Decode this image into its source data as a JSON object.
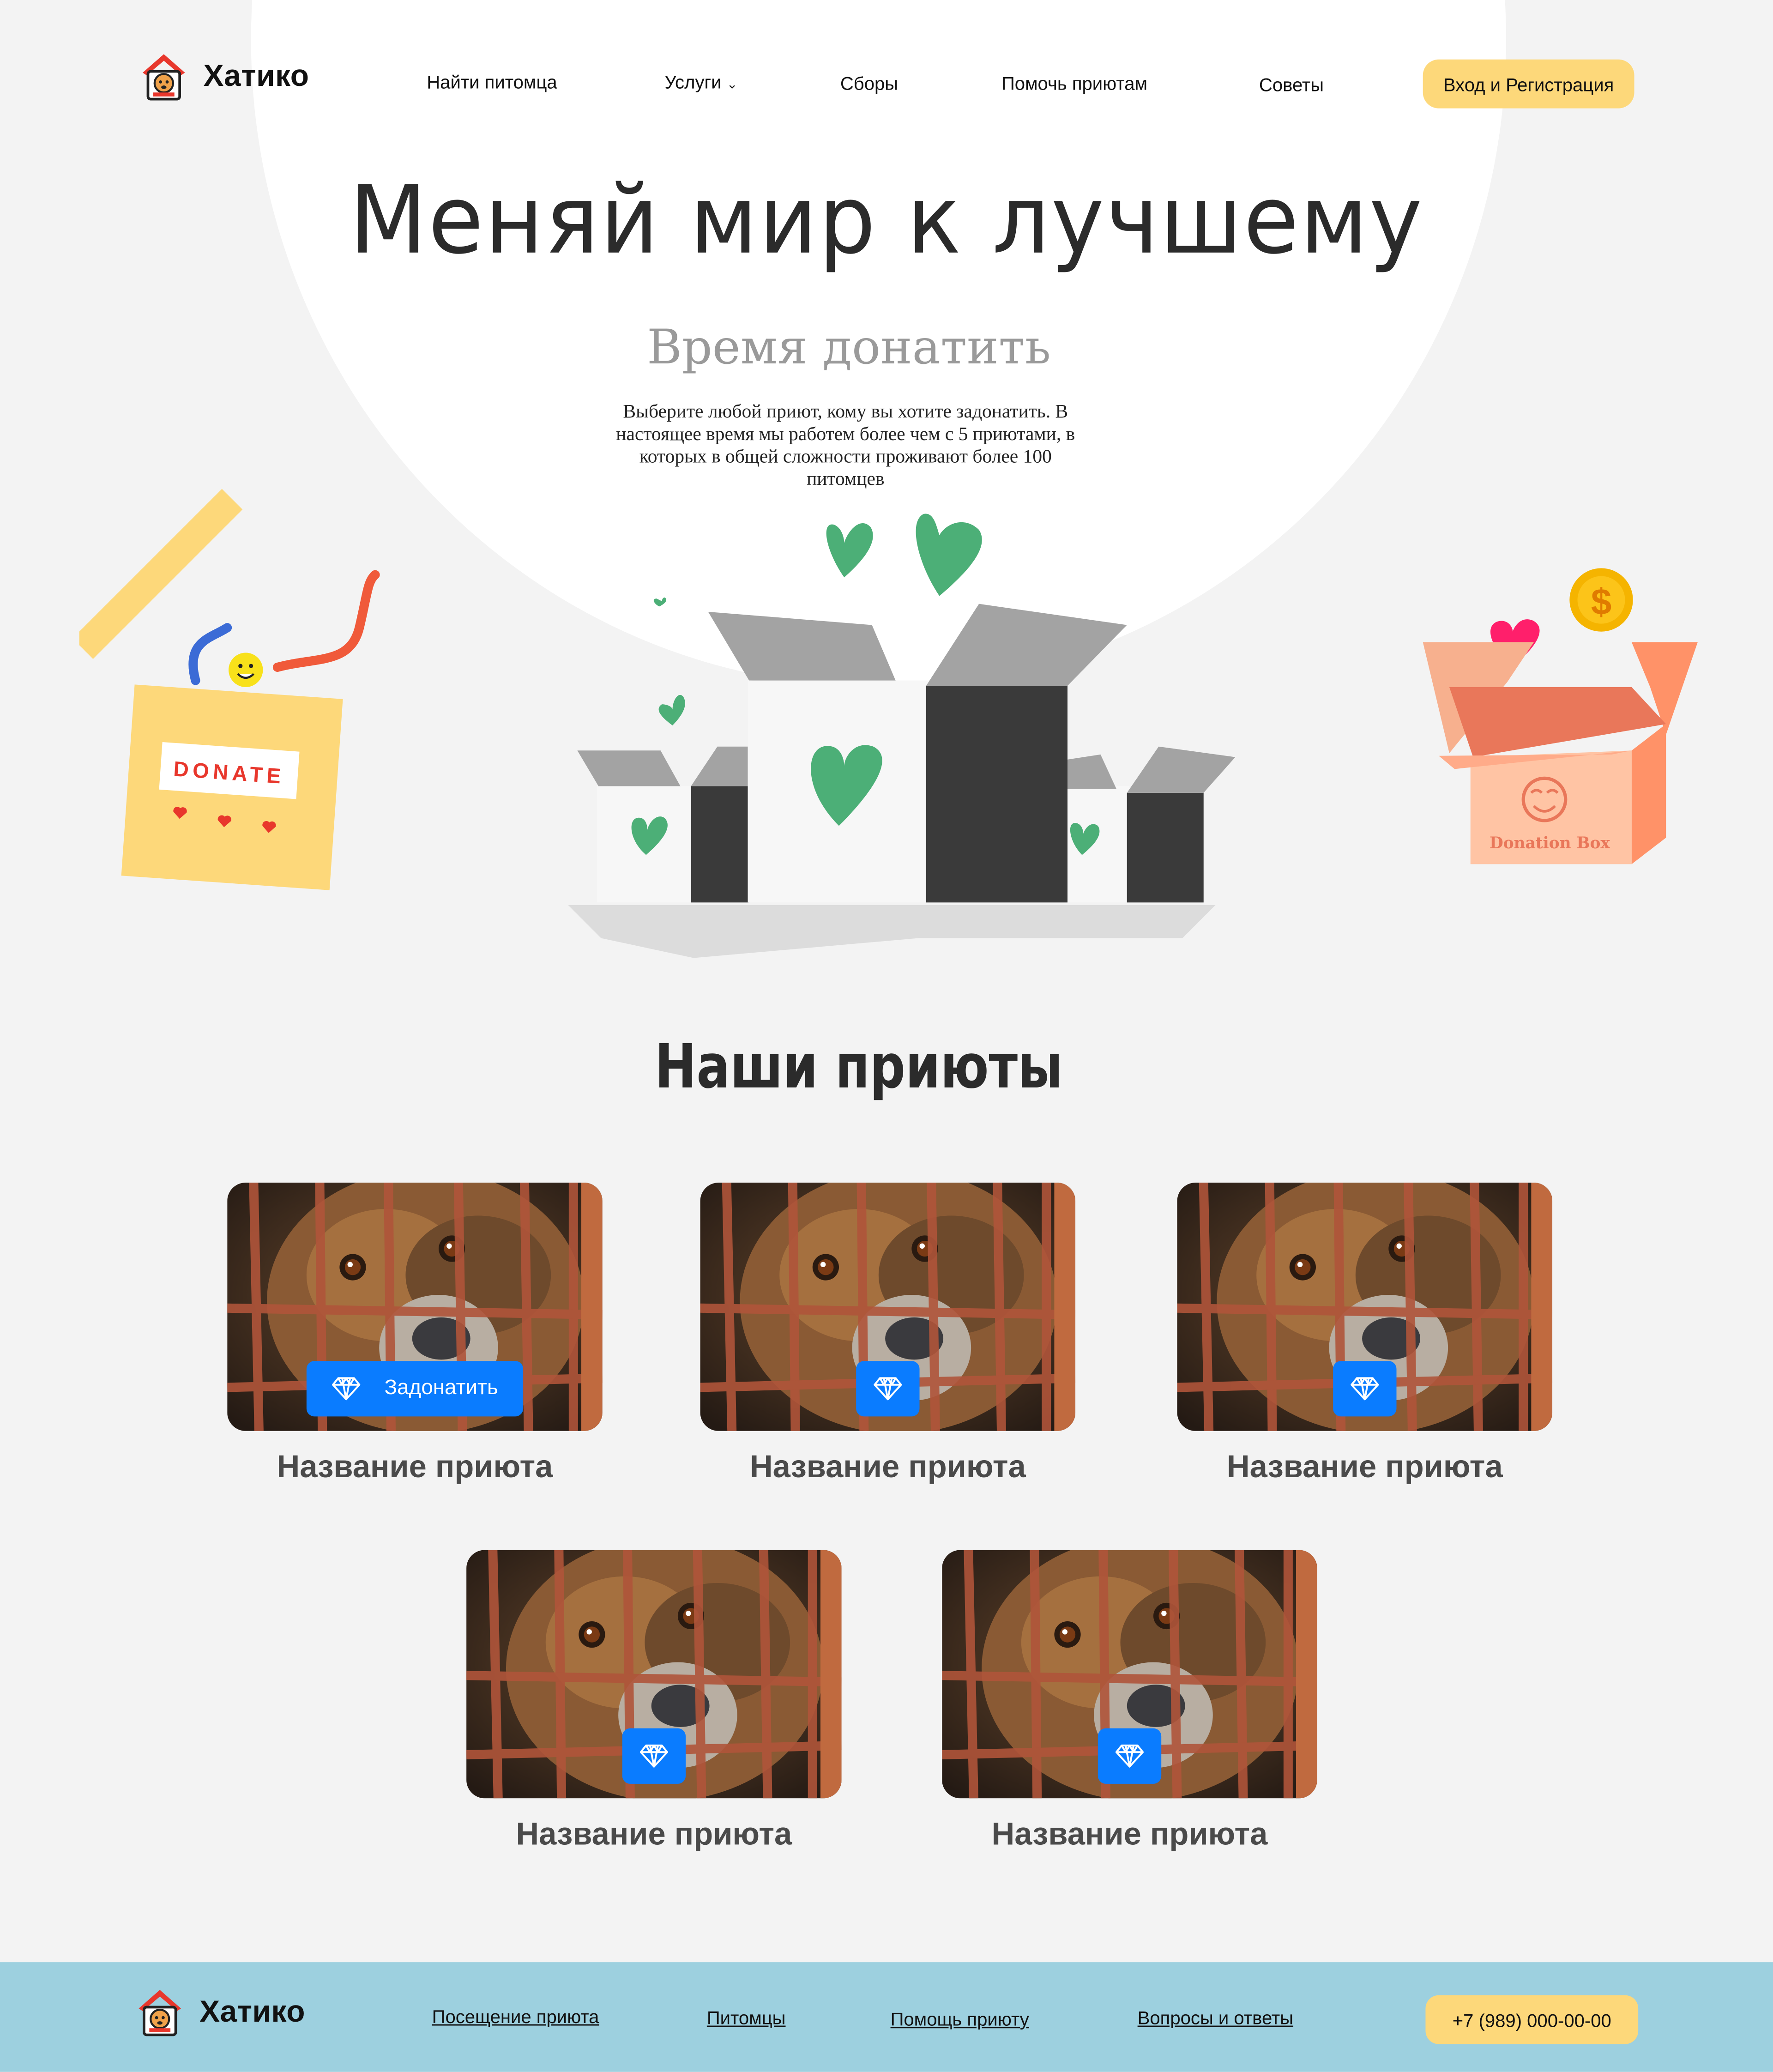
{
  "brand": {
    "name": "Хатико",
    "logo_icon": "dog-house-icon"
  },
  "nav": {
    "items": [
      "Найти питомца",
      "Услуги",
      "Сборы",
      "Помочь приютам",
      "Советы"
    ],
    "login": "Вход и Регистрация"
  },
  "hero": {
    "title": "Меняй мир к лучшему",
    "subtitle": "Время донатить",
    "text": "Выберите любой приют, кому вы хотите задонатить. В настоящее время мы работем более чем с 5 приютами, в которых в общей сложности проживают более 100 питомцев",
    "donate_box_label": "DONATE",
    "donation_box_label": "Donation Box",
    "coin_symbol": "$"
  },
  "shelters": {
    "title": "Наши приюты",
    "donate_label": "Задонатить",
    "items": [
      {
        "name": "Название приюта",
        "expanded": true
      },
      {
        "name": "Название приюта",
        "expanded": false
      },
      {
        "name": "Название приюта",
        "expanded": false
      },
      {
        "name": "Название приюта",
        "expanded": false
      },
      {
        "name": "Название приюта",
        "expanded": false
      }
    ]
  },
  "footer": {
    "links": [
      "Посещение приюта",
      "Питомцы",
      "Помощь приюту",
      "Вопросы и ответы"
    ],
    "phone": "+7 (989) 000-00-00"
  },
  "colors": {
    "accent_yellow": "#fdd87a",
    "donate_blue": "#0a7cff",
    "footer_bg": "#9dd0df",
    "heart_green": "#4caf77"
  }
}
